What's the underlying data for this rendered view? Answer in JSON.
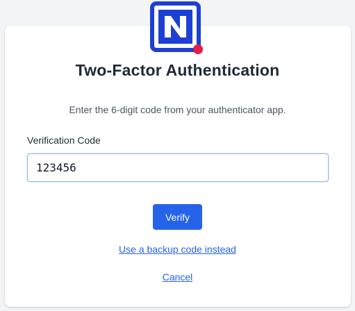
{
  "logo": {
    "icon": "n-logo-icon",
    "brand_color": "#1d3fd4",
    "dot_color": "#e11d48"
  },
  "title": "Two-Factor Authentication",
  "subtitle": "Enter the 6-digit code from your authenticator app.",
  "verification": {
    "label": "Verification Code",
    "value": "123456"
  },
  "actions": {
    "verify_label": "Verify",
    "backup_link": "Use a backup code instead",
    "cancel_link": "Cancel"
  },
  "colors": {
    "accent": "#2563eb",
    "text": "#1f2937"
  }
}
